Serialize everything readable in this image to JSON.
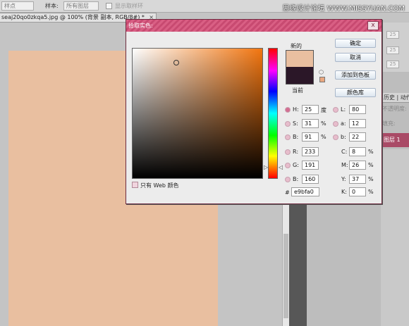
{
  "optbar": {
    "dropdown1": "样点",
    "sample_label": "样本:",
    "dropdown2": "所有图层",
    "checkbox_label": "显示取样环",
    "watermark": "思缘设计论坛 WWW.MISSYUAN.COM"
  },
  "doc_tab": {
    "title": "seaj20qo0zkqa5.jpg @ 100% (背景 副本, RGB/8#) *",
    "close": "×"
  },
  "right_panel": {
    "slider_values": [
      "25",
      "25",
      "25"
    ],
    "tabs_label": "历史 | 动作",
    "opacity_label": "不透明度:",
    "fill_label": "填充:",
    "layer_name": "图层 1"
  },
  "dialog": {
    "title": "拾取实色:",
    "close": "x",
    "new_label": "新的",
    "current_label": "当前",
    "new_color": "#e9bfa0",
    "current_color": "#2b1728",
    "buttons": {
      "ok": "确定",
      "cancel": "取消",
      "add_swatch": "添加到色板",
      "libraries": "颜色库"
    },
    "hsb": {
      "h_label": "H:",
      "h": "25",
      "h_unit": "度",
      "s_label": "S:",
      "s": "31",
      "s_unit": "%",
      "b_label": "B:",
      "b": "91",
      "b_unit": "%"
    },
    "rgb": {
      "r_label": "R:",
      "r": "233",
      "g_label": "G:",
      "g": "191",
      "b_label": "B:",
      "b": "160"
    },
    "lab": {
      "l_label": "L:",
      "l": "80",
      "a_label": "a:",
      "a": "12",
      "b_label": "b:",
      "b": "22"
    },
    "cmyk": {
      "c_label": "C:",
      "c": "8",
      "m_label": "M:",
      "m": "26",
      "y_label": "Y:",
      "y": "37",
      "k_label": "K:",
      "k": "0",
      "unit": "%"
    },
    "hex_label": "#",
    "hex": "e9bfa0",
    "web_only": "只有 Web 颜色"
  }
}
